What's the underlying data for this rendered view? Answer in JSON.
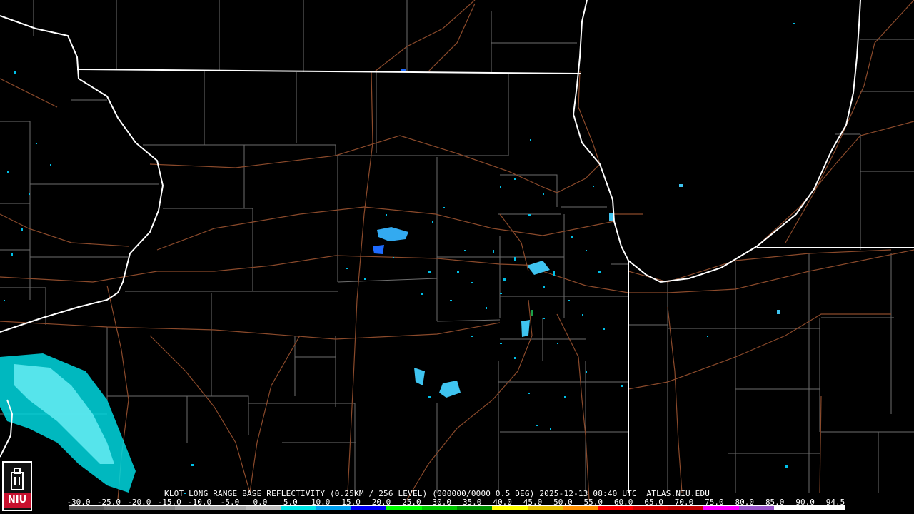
{
  "product": {
    "caption": "KLOT LONG RANGE BASE REFLECTIVITY (0.25KM / 256 LEVEL) (000000/0000 0.5 DEG) 2025-12-13 08:40 UTC  ATLAS.NIU.EDU"
  },
  "legend": {
    "scale_labels": [
      "-30.0",
      "-25.0",
      "-20.0",
      "-15.0",
      "-10.0",
      "-5.0",
      "0.0",
      "5.0",
      "10.0",
      "15.0",
      "20.0",
      "25.0",
      "30.0",
      "35.0",
      "40.0",
      "45.0",
      "50.0",
      "55.0",
      "60.0",
      "65.0",
      "70.0",
      "75.0",
      "80.0",
      "85.0",
      "90.0",
      "94.5"
    ],
    "colors": [
      "#5a5a5a",
      "#6e6e6e",
      "#828282",
      "#969696",
      "#aaaaaa",
      "#bebebe",
      "#00e6e6",
      "#00a0f0",
      "#0000f6",
      "#00ff00",
      "#00c800",
      "#009000",
      "#ffff00",
      "#e7c000",
      "#ff9000",
      "#ff0000",
      "#d60000",
      "#c00000",
      "#ff00ff",
      "#9955c9",
      "#ffffff",
      "#ffffff"
    ]
  },
  "logo": {
    "text": "NIU"
  },
  "style": {
    "background": "#000000",
    "state_border_color": "#ffffff",
    "county_line_color": "#6e6e6e",
    "highway_color": "#8b4a2b",
    "echo_colors": [
      "#00e6e6",
      "#3fc4f0",
      "#1e6bff",
      "#1aa048"
    ]
  }
}
